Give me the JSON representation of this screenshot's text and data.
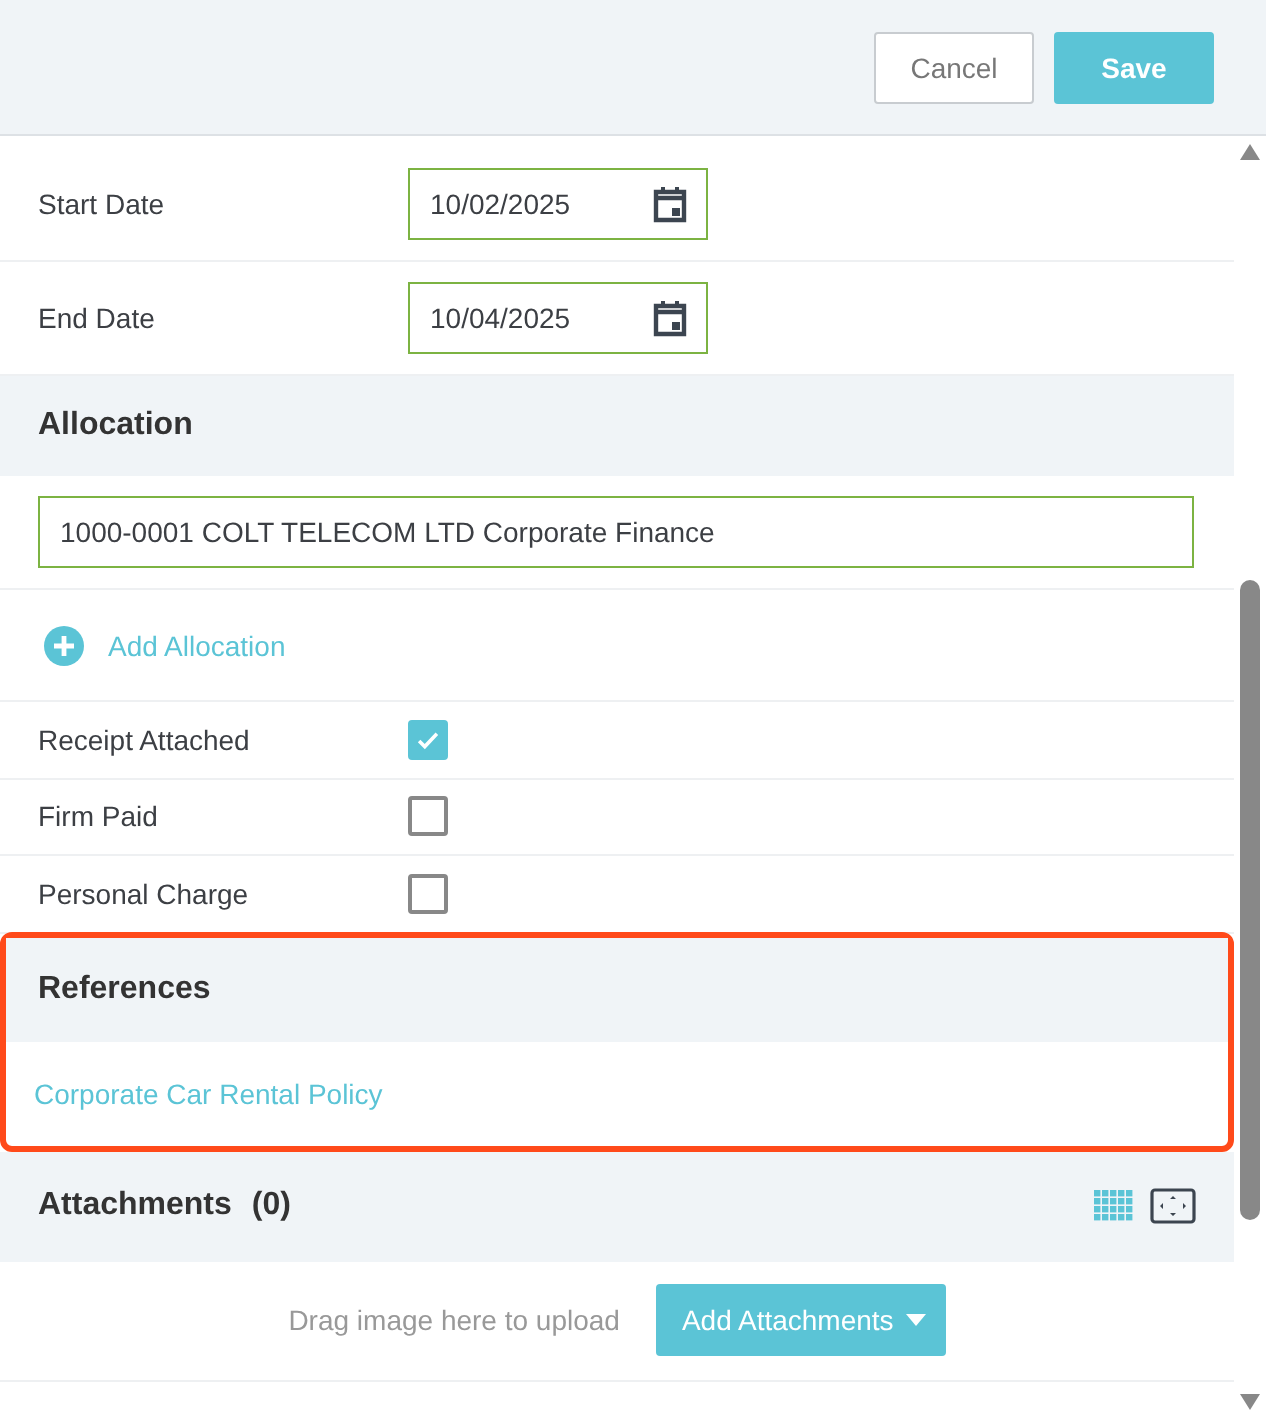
{
  "header": {
    "buttons": [
      {
        "label": "Cancel",
        "kind": "secondary"
      },
      {
        "label": "Save",
        "kind": "primary"
      }
    ]
  },
  "dates": [
    {
      "label": "Start Date",
      "value": "10/02/2025"
    },
    {
      "label": "End Date",
      "value": "10/04/2025"
    }
  ],
  "allocation": {
    "title": "Allocation",
    "value": "1000-0001 COLT TELECOM LTD Corporate Finance",
    "add_label": "Add Allocation"
  },
  "flags": [
    {
      "label": "Receipt Attached",
      "checked": true
    },
    {
      "label": "Firm Paid",
      "checked": false
    },
    {
      "label": "Personal Charge",
      "checked": false
    }
  ],
  "references": {
    "title": "References",
    "highlighted": true,
    "links": [
      "Corporate Car Rental Policy"
    ]
  },
  "attachments": {
    "title": "Attachments",
    "count": "(0)",
    "hint": "Drag image here to upload",
    "button": "Add Attachments"
  }
}
